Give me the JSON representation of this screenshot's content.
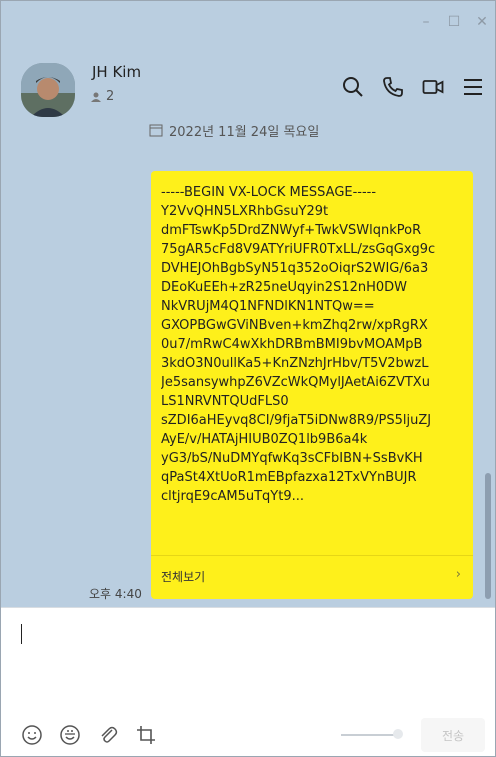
{
  "window": {
    "controls": {
      "minimize": "–",
      "maximize": "☐",
      "close": "✕"
    }
  },
  "chat": {
    "name": "JH Kim",
    "member_count": "2",
    "date_divider": "2022년 11월 24일 목요일",
    "icons": [
      "search-icon",
      "phone-icon",
      "video-call-icon",
      "menu-icon"
    ]
  },
  "message": {
    "lines": [
      "-----BEGIN VX-LOCK MESSAGE-----",
      "Y2VvQHN5LXRhbGsuY29t",
      "dmFTswKp5DrdZNWyf+TwkVSWlqnkPoR",
      "75gAR5cFd8V9ATYriUFR0TxLL/zsGqGxg9c",
      "DVHEJOhBgbSyN51q352oOiqrS2WIG/6a3",
      "DEoKuEEh+zR25neUqyin2S12nH0DW",
      "NkVRUjM4Q1NFNDlKN1NTQw==",
      "GXOPBGwGViNBven+kmZhq2rw/xpRgRX",
      "0u7/mRwC4wXkhDRBmBMI9bvMOAMpB",
      "3kdO3N0ullKa5+KnZNzhJrHbv/T5V2bwzL",
      "Je5sansywhpZ6VZcWkQMylJAetAi6ZVTXu",
      "LS1NRVNTQUdFLS0",
      "sZDI6aHEyvq8CI/9fjaT5iDNw8R9/PS5ljuZJ",
      "AyE/v/HATAjHIUB0ZQ1lb9B6a4k",
      "yG3/bS/NuDMYqfwKq3sCFbIBN+SsBvKH",
      "qPaSt4XtUoR1mEBpfazxa12TxVYnBUJR",
      "cltjrqE9cAM5uTqYt9..."
    ],
    "view_all": "전체보기",
    "time": "오후 4:40",
    "bubble_color": "#fef01b"
  },
  "input": {
    "value": "",
    "send_label": "전송",
    "tools": [
      "emoji-icon",
      "emoticon-icon",
      "attach-icon",
      "capture-icon"
    ]
  }
}
